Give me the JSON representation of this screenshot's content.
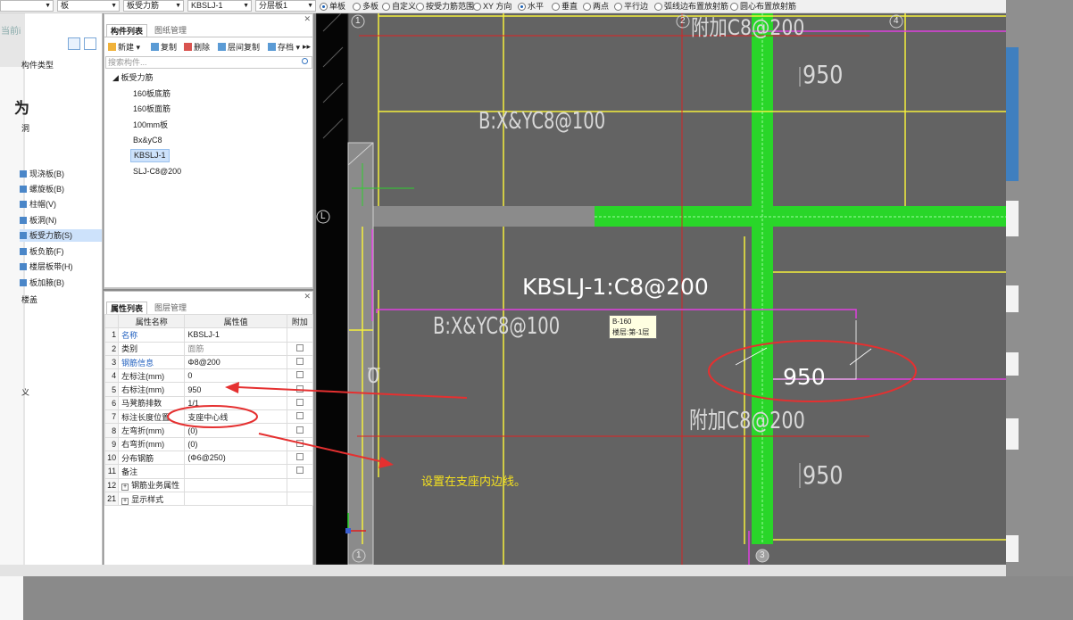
{
  "toolbar": {
    "selects": [
      "板",
      "板受力筋",
      "KBSLJ-1",
      "分层板1"
    ],
    "first_select_value": "",
    "radios": [
      {
        "label": "单板",
        "checked": true
      },
      {
        "label": "多板",
        "checked": false
      },
      {
        "label": "自定义",
        "checked": false
      },
      {
        "label": "按受力筋范围",
        "checked": false
      },
      {
        "label": "XY 方向",
        "checked": false
      },
      {
        "label": "水平",
        "checked": true
      },
      {
        "label": "垂直",
        "checked": false
      },
      {
        "label": "两点",
        "checked": false
      },
      {
        "label": "平行边",
        "checked": false
      },
      {
        "label": "弧线边布置放射筋",
        "checked": false
      },
      {
        "label": "圆心布置放射筋",
        "checked": false
      }
    ]
  },
  "left_strip": {
    "text": "当前i"
  },
  "navigator": {
    "header": "构件类型",
    "items": [
      "现浇板(B)",
      "螺旋板(B)",
      "柱帽(V)",
      "板洞(N)",
      "板受力筋(S)",
      "板负筋(F)",
      "楼层板带(H)",
      "板加腋(B)"
    ],
    "selected": "板受力筋(S)",
    "footer": "楼盖",
    "big_glyph": "为",
    "small_label": "洞",
    "lower_label": "义"
  },
  "component_panel": {
    "tabs": [
      "构件列表",
      "图纸管理"
    ],
    "active_tab": "构件列表",
    "tools": [
      "新建",
      "复制",
      "删除",
      "层间复制",
      "存档"
    ],
    "search_placeholder": "搜索构件...",
    "tree_root": "板受力筋",
    "tree_items": [
      "160板底筋",
      "160板面筋",
      "100mm板",
      "Bx&yC8",
      "KBSLJ-1",
      "SLJ-C8@200"
    ],
    "selected": "KBSLJ-1"
  },
  "property_panel": {
    "tabs": [
      "属性列表",
      "图层管理"
    ],
    "active_tab": "属性列表",
    "columns": [
      "属性名称",
      "属性值",
      "附加"
    ],
    "rows": [
      {
        "num": "1",
        "name": "名称",
        "value": "KBSLJ-1",
        "name_color": "blue",
        "has_check": false
      },
      {
        "num": "2",
        "name": "类别",
        "value": "面筋",
        "name_color": "normal",
        "value_color": "gray",
        "has_check": true
      },
      {
        "num": "3",
        "name": "钢筋信息",
        "value": "Φ8@200",
        "name_color": "blue",
        "has_check": true
      },
      {
        "num": "4",
        "name": "左标注(mm)",
        "value": "0",
        "name_color": "normal",
        "has_check": true
      },
      {
        "num": "5",
        "name": "右标注(mm)",
        "value": "950",
        "name_color": "normal",
        "has_check": true
      },
      {
        "num": "6",
        "name": "马凳筋排数",
        "value": "1/1",
        "name_color": "normal",
        "has_check": true
      },
      {
        "num": "7",
        "name": "标注长度位置",
        "value": "支座中心线",
        "name_color": "normal",
        "has_check": true
      },
      {
        "num": "8",
        "name": "左弯折(mm)",
        "value": "(0)",
        "name_color": "normal",
        "has_check": true
      },
      {
        "num": "9",
        "name": "右弯折(mm)",
        "value": "(0)",
        "name_color": "normal",
        "has_check": true
      },
      {
        "num": "10",
        "name": "分布钢筋",
        "value": "(Φ6@250)",
        "name_color": "normal",
        "has_check": true
      },
      {
        "num": "11",
        "name": "备注",
        "value": "",
        "name_color": "normal",
        "has_check": true
      },
      {
        "num": "12",
        "name": "钢筋业务属性",
        "value": "",
        "name_color": "normal",
        "has_check": false,
        "expand": true
      },
      {
        "num": "21",
        "name": "显示样式",
        "value": "",
        "name_color": "normal",
        "has_check": false,
        "expand": true
      }
    ]
  },
  "canvas": {
    "axis_labels": [
      "1",
      "2",
      "4",
      "L",
      "1",
      "3"
    ],
    "annotations": {
      "top_rebar": "附加C8@200",
      "dim_950_top": "950",
      "slab_upper": "B:X&YC8@100",
      "main_label": "KBSLJ-1:C8@200",
      "slab_lower": "B:X&YC8@100",
      "dim_950_mid": "950",
      "dim_zero": "0",
      "mid_rebar": "附加C8@200",
      "dim_950_low": "950"
    },
    "tooltip": {
      "line1": "B-160",
      "line2": "楼层:第-1层"
    },
    "callout_note": "设置在支座内边线。",
    "colors": {
      "background": "#636363",
      "beam_green": "#29d629",
      "axis_yellow": "#f5f03c",
      "rebar_magenta": "#e040e0",
      "grid_red": "#e02020",
      "annotation_red": "#e53030",
      "note_yellow": "#f5e11e"
    }
  }
}
